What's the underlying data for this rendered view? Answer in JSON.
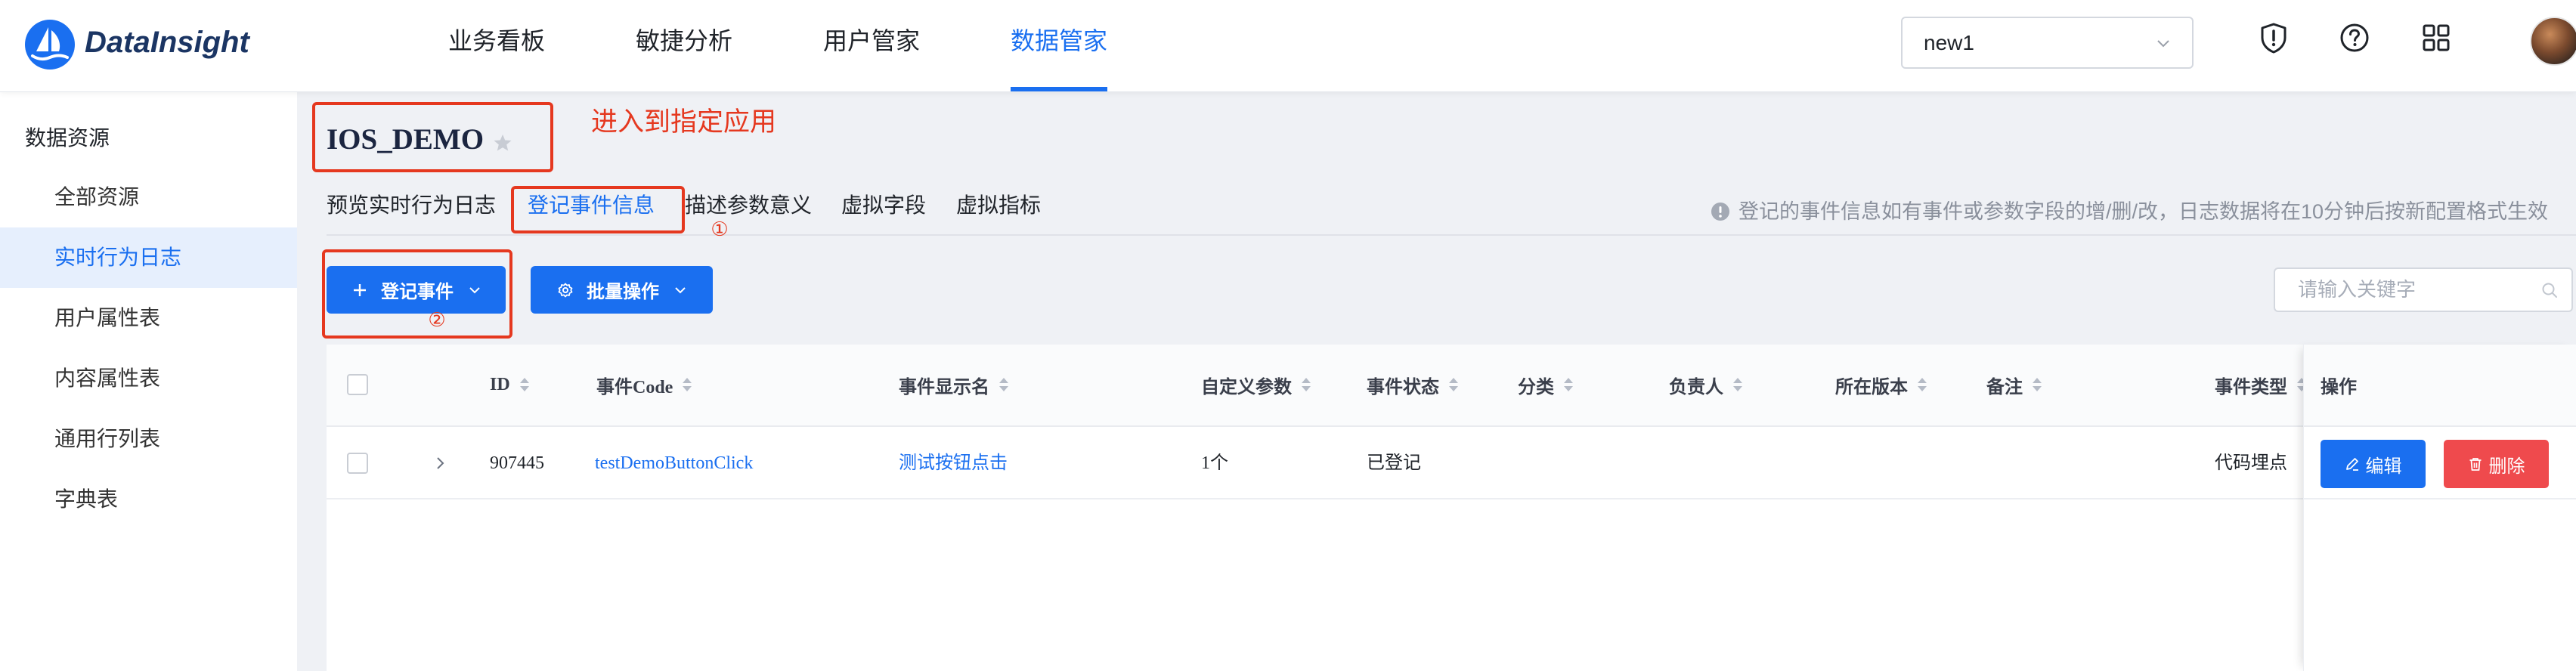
{
  "theme": {
    "primary": "#1a6ff0",
    "danger": "#ef4a4d",
    "annotation": "#e5381f"
  },
  "header": {
    "logo_text": "DataInsight",
    "nav": {
      "active_index": 3,
      "items": [
        "业务看板",
        "敏捷分析",
        "用户管家",
        "数据管家"
      ]
    },
    "project_select": {
      "value": "new1"
    },
    "icons": {
      "alert": "shield-alert-icon",
      "help": "help-circle-icon",
      "apps": "apps-grid-icon",
      "user": "avatar"
    }
  },
  "sidebar": {
    "title": "数据资源",
    "active_index": 1,
    "items": [
      "全部资源",
      "实时行为日志",
      "用户属性表",
      "内容属性表",
      "通用行列表",
      "字典表"
    ]
  },
  "page": {
    "title": "IOS_DEMO",
    "tabs": {
      "active_index": 1,
      "items": [
        "预览实时行为日志",
        "登记事件信息",
        "描述参数意义",
        "虚拟字段",
        "虚拟指标"
      ]
    },
    "notice": "登记的事件信息如有事件或参数字段的增/删/改，日志数据将在10分钟后按新配置格式生效"
  },
  "annotations": {
    "enter_app": "进入到指定应用",
    "step_1": "①",
    "step_2": "②"
  },
  "toolbar": {
    "register_button": "登记事件",
    "batch_button": "批量操作",
    "search_placeholder": "请输入关键字"
  },
  "table": {
    "columns": [
      "ID",
      "事件Code",
      "事件显示名",
      "自定义参数",
      "事件状态",
      "分类",
      "负责人",
      "所在版本",
      "备注",
      "事件类型"
    ],
    "action_column": "操作",
    "rows": [
      {
        "id": "907445",
        "code": "testDemoButtonClick",
        "display_name": "测试按钮点击",
        "custom_params": "1个",
        "status": "已登记",
        "event_type": "代码埋点",
        "edit_label": "编辑",
        "delete_label": "删除"
      }
    ]
  }
}
